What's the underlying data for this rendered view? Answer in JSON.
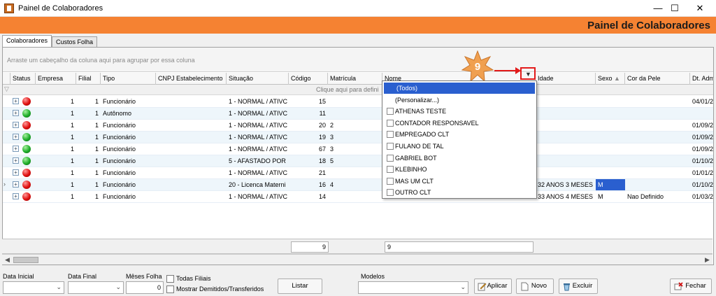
{
  "window": {
    "title": "Painel de Colaboradores",
    "controls": {
      "minimize": "—",
      "maximize": "☐",
      "close": "✕"
    }
  },
  "banner": {
    "title": "Painel de Colaboradores",
    "color": "#f58232"
  },
  "tabs": [
    {
      "label": "Colaboradores",
      "active": true
    },
    {
      "label": "Custos Folha",
      "active": false
    }
  ],
  "grid": {
    "group_hint": "Arraste um cabeçalho da coluna aqui para agrupar por essa coluna",
    "filter_hint": "Clique aqui para defini",
    "columns": [
      "Status",
      "Empresa",
      "Filial",
      "Tipo",
      "CNPJ Estabelecimento",
      "Situação",
      "Código",
      "Matrícula",
      "Nome",
      "Idade",
      "Sexo",
      "Cor da Pele",
      "Dt. Adm"
    ],
    "rows": [
      {
        "status": "red",
        "empresa": "1",
        "filial": "1",
        "tipo": "Funcionário",
        "situacao": "1 - NORMAL / ATIVC",
        "codigo": "15",
        "matricula": "",
        "nome": "",
        "idade": "",
        "sexo": "",
        "cor": "",
        "dtadm": "04/01/2"
      },
      {
        "status": "green",
        "empresa": "1",
        "filial": "1",
        "tipo": "Autônomo",
        "situacao": "1 - NORMAL / ATIVC",
        "codigo": "11",
        "matricula": "",
        "nome": "",
        "idade": "",
        "sexo": "",
        "cor": "",
        "dtadm": ""
      },
      {
        "status": "red",
        "empresa": "1",
        "filial": "1",
        "tipo": "Funcionário",
        "situacao": "1 - NORMAL / ATIVC",
        "codigo": "20",
        "matricula": "2",
        "nome": "",
        "idade": "",
        "sexo": "",
        "cor": "",
        "dtadm": "01/09/2"
      },
      {
        "status": "green",
        "empresa": "1",
        "filial": "1",
        "tipo": "Funcionário",
        "situacao": "1 - NORMAL / ATIVC",
        "codigo": "19",
        "matricula": "3",
        "nome": "",
        "idade": "",
        "sexo": "",
        "cor": "",
        "dtadm": "01/09/2"
      },
      {
        "status": "green",
        "empresa": "1",
        "filial": "1",
        "tipo": "Funcionário",
        "situacao": "1 - NORMAL / ATIVC",
        "codigo": "67",
        "matricula": "3",
        "nome": "",
        "idade": "",
        "sexo": "",
        "cor": "",
        "dtadm": "01/09/2"
      },
      {
        "status": "green",
        "empresa": "1",
        "filial": "1",
        "tipo": "Funcionário",
        "situacao": "5 - AFASTADO POR",
        "codigo": "18",
        "matricula": "5",
        "nome": "",
        "idade": "",
        "sexo": "",
        "cor": "",
        "dtadm": "01/10/2"
      },
      {
        "status": "red",
        "empresa": "1",
        "filial": "1",
        "tipo": "Funcionário",
        "situacao": "1 - NORMAL / ATIVC",
        "codigo": "21",
        "matricula": "",
        "nome": "",
        "idade": "",
        "sexo": "",
        "cor": "",
        "dtadm": "01/01/2"
      },
      {
        "status": "red",
        "empresa": "1",
        "filial": "1",
        "tipo": "Funcionário",
        "situacao": "20 - Licenca Materni",
        "codigo": "16",
        "matricula": "4",
        "nome": "",
        "idade": "32 ANOS 3 MESES",
        "sexo": "M",
        "cor": "",
        "dtadm": "01/10/2"
      },
      {
        "status": "red",
        "empresa": "1",
        "filial": "1",
        "tipo": "Funcionário",
        "situacao": "1 - NORMAL / ATIVC",
        "codigo": "14",
        "matricula": "",
        "nome": "FULANO DE TAL",
        "idade": "33 ANOS 4 MESES",
        "sexo": "M",
        "cor": "Nao Definido",
        "dtadm": "01/03/2"
      }
    ],
    "footer_count_codigo": "9",
    "footer_count_nome": "9"
  },
  "filter_popup": {
    "items": [
      "(Todos)",
      "(Personalizar...)",
      "ATHENAS TESTE",
      "CONTADOR RESPONSAVEL",
      "EMPREGADO CLT",
      "FULANO DE TAL",
      "GABRIEL BOT",
      "KLEBINHO",
      "MAS UM CLT",
      "OUTRO CLT"
    ]
  },
  "annotation": {
    "number": "9"
  },
  "toolbar": {
    "data_inicial_label": "Data Inicial",
    "data_final_label": "Data Final",
    "meses_folha_label": "Mêses Folha",
    "meses_folha_value": "0",
    "todas_filiais_label": "Todas Filiais",
    "mostrar_demitidos_label": "Mostrar Demitidos/Transferidos",
    "listar_label": "Listar",
    "modelos_label": "Modelos",
    "aplicar_label": "Aplicar",
    "novo_label": "Novo",
    "excluir_label": "Excluir",
    "fechar_label": "Fechar"
  }
}
